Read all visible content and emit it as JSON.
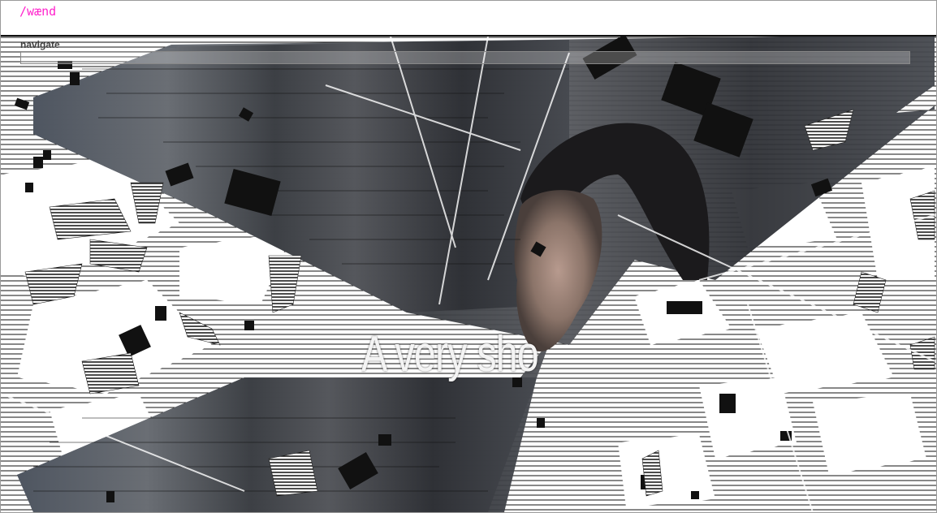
{
  "app": {
    "brand": "/wænd",
    "brand_color": "#ff22cc"
  },
  "navigation": {
    "label": "navigate",
    "input_value": "",
    "input_placeholder": ""
  },
  "map": {
    "overlay_text": "A very sho"
  }
}
